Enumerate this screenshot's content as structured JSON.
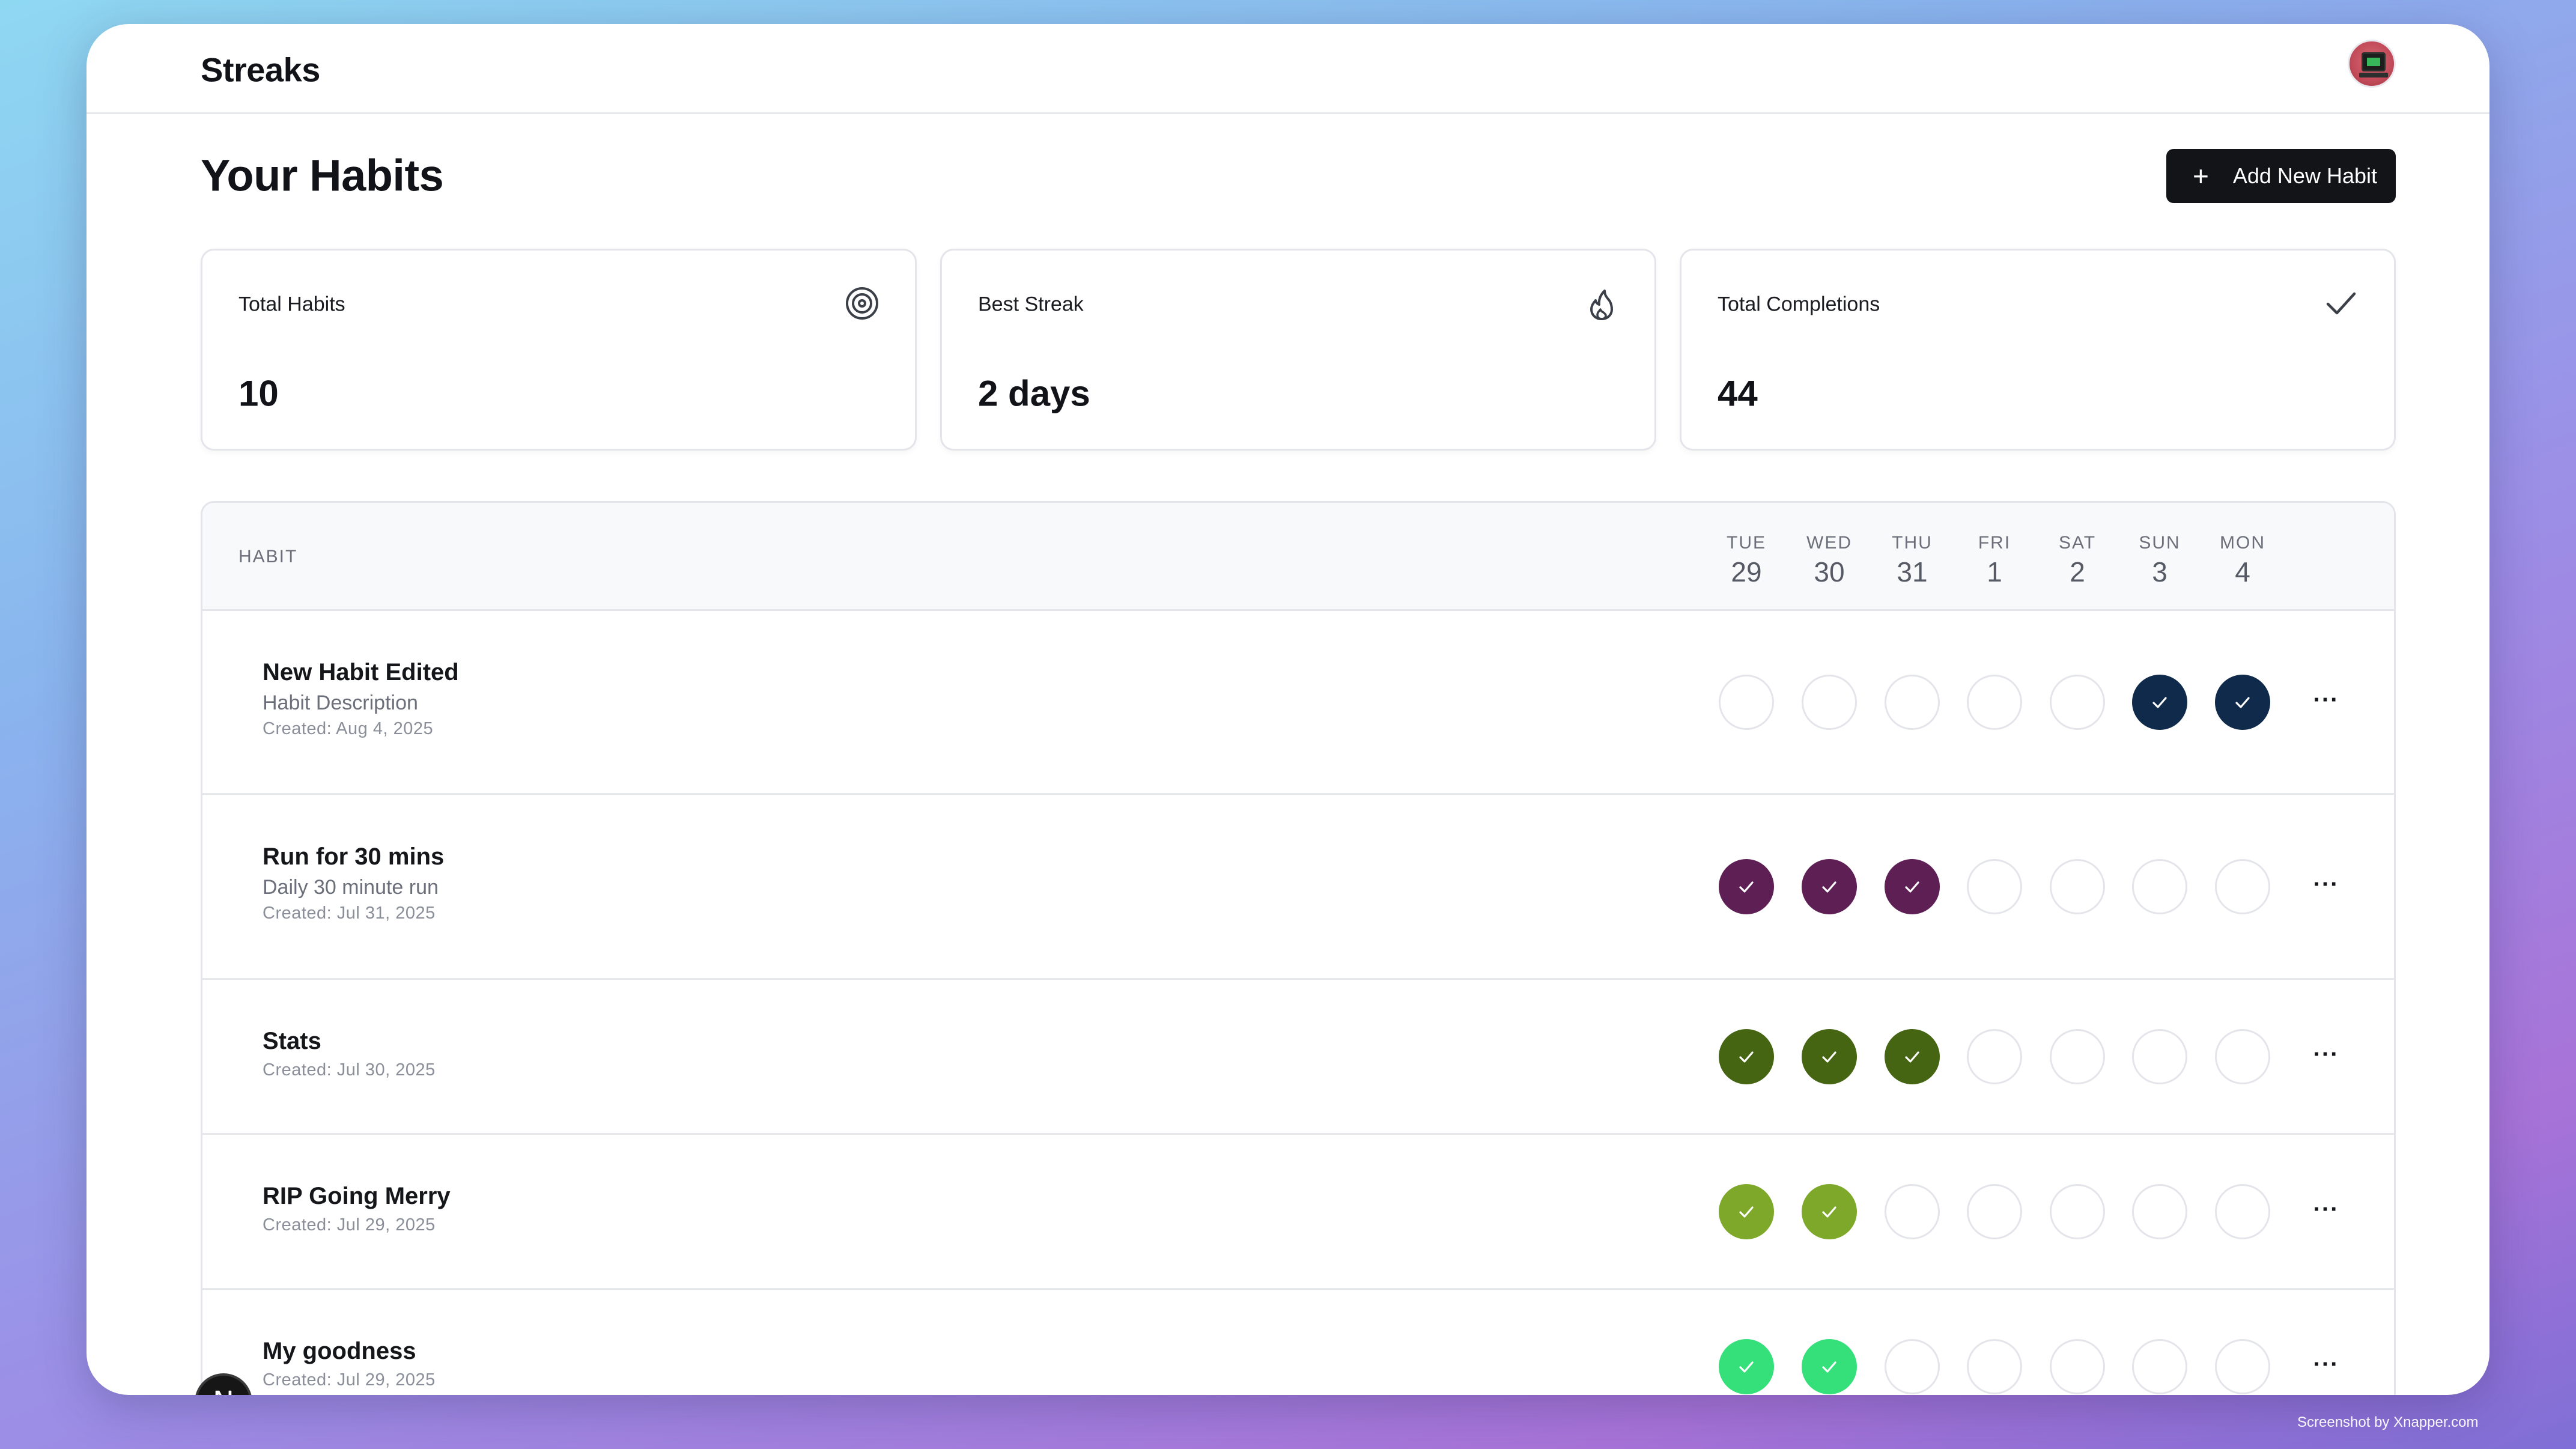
{
  "app": {
    "title": "Streaks"
  },
  "header": {
    "title": "Your Habits",
    "add_button_label": "Add New Habit"
  },
  "stats": [
    {
      "label": "Total Habits",
      "value": "10",
      "icon": "target-icon"
    },
    {
      "label": "Best Streak",
      "value": "2 days",
      "icon": "flame-icon"
    },
    {
      "label": "Total Completions",
      "value": "44",
      "icon": "check-icon"
    }
  ],
  "table": {
    "habit_header": "HABIT",
    "days": [
      {
        "name": "TUE",
        "date": "29"
      },
      {
        "name": "WED",
        "date": "30"
      },
      {
        "name": "THU",
        "date": "31"
      },
      {
        "name": "FRI",
        "date": "1"
      },
      {
        "name": "SAT",
        "date": "2"
      },
      {
        "name": "SUN",
        "date": "3"
      },
      {
        "name": "MON",
        "date": "4"
      }
    ],
    "rows": [
      {
        "name": "New Habit Edited",
        "description": "Habit Description",
        "created": "Created: Aug 4, 2025",
        "color": "#0f2a4a",
        "completed": [
          false,
          false,
          false,
          false,
          false,
          true,
          true
        ]
      },
      {
        "name": "Run for 30 mins",
        "description": "Daily 30 minute run",
        "created": "Created: Jul 31, 2025",
        "color": "#5e1f55",
        "completed": [
          true,
          true,
          true,
          false,
          false,
          false,
          false
        ]
      },
      {
        "name": "Stats",
        "description": "",
        "created": "Created: Jul 30, 2025",
        "color": "#466512",
        "completed": [
          true,
          true,
          true,
          false,
          false,
          false,
          false
        ]
      },
      {
        "name": "RIP Going Merry",
        "description": "",
        "created": "Created: Jul 29, 2025",
        "color": "#7ea82a",
        "completed": [
          true,
          true,
          false,
          false,
          false,
          false,
          false
        ]
      },
      {
        "name": "My goodness",
        "description": "",
        "created": "Created: Jul 29, 2025",
        "color": "#35e07a",
        "completed": [
          true,
          true,
          false,
          false,
          false,
          false,
          false
        ]
      }
    ],
    "more_label": "···"
  },
  "badge": {
    "letter": "N"
  },
  "watermark": "Screenshot by Xnapper.com"
}
